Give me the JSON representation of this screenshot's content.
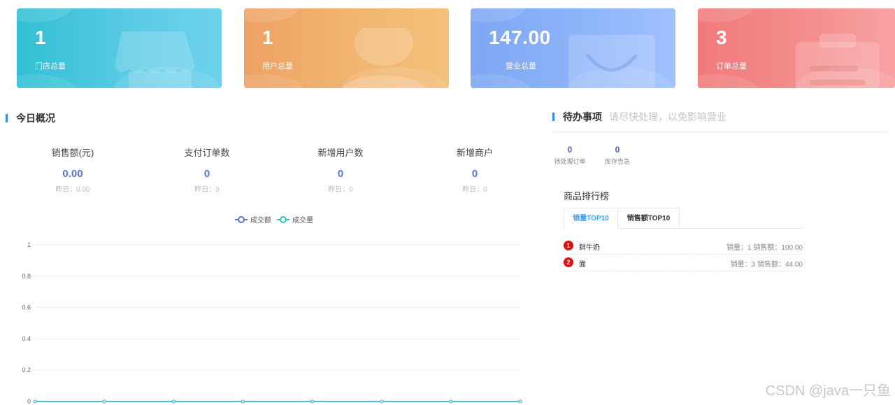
{
  "cards": [
    {
      "value": "1",
      "label": "门店总量",
      "icon": "store-icon"
    },
    {
      "value": "1",
      "label": "用户总量",
      "icon": "user-icon"
    },
    {
      "value": "147.00",
      "label": "营业总量",
      "icon": "bag-icon"
    },
    {
      "value": "3",
      "label": "订单总量",
      "icon": "clipboard-icon"
    }
  ],
  "today": {
    "title": "今日概况",
    "stats": [
      {
        "label": "销售额(元)",
        "value": "0.00",
        "yesterday": "昨日：0.00"
      },
      {
        "label": "支付订单数",
        "value": "0",
        "yesterday": "昨日：0"
      },
      {
        "label": "新增用户数",
        "value": "0",
        "yesterday": "昨日：0"
      },
      {
        "label": "新增商户",
        "value": "0",
        "yesterday": "昨日：0"
      }
    ]
  },
  "todo": {
    "title": "待办事项",
    "subtitle": "请尽快处理，以免影响营业",
    "items": [
      {
        "count": "0",
        "label": "待处理订单"
      },
      {
        "count": "0",
        "label": "库存告急"
      }
    ]
  },
  "ranking": {
    "title": "商品排行榜",
    "tabs": [
      "销量TOP10",
      "销售额TOP10"
    ],
    "rows": [
      {
        "rank": "1",
        "name": "鲜牛奶",
        "meta": "销量：1 销售额：100.00"
      },
      {
        "rank": "2",
        "name": "面",
        "meta": "销量：3 销售额：44.00"
      }
    ]
  },
  "watermark": "CSDN @java一只鱼",
  "colors": {
    "accent": "#2d8cf0",
    "series_amount": "#5a72d9",
    "series_volume": "#2fc1c6",
    "rank_badge": "#e01010"
  },
  "chart_data": {
    "type": "line",
    "x": [
      "",
      "",
      "",
      "",
      "",
      "",
      "",
      ""
    ],
    "series": [
      {
        "name": "成交额",
        "values": [
          0,
          0,
          0,
          0,
          0,
          0,
          0,
          0
        ]
      },
      {
        "name": "成交量",
        "values": [
          0,
          0,
          0,
          0,
          0,
          0,
          0,
          0
        ]
      }
    ],
    "yticks": [
      "0",
      "0.2",
      "0.4",
      "0.6",
      "0.8",
      "1"
    ],
    "ylim": [
      0,
      1
    ],
    "grid": true,
    "legend": "top-center"
  }
}
